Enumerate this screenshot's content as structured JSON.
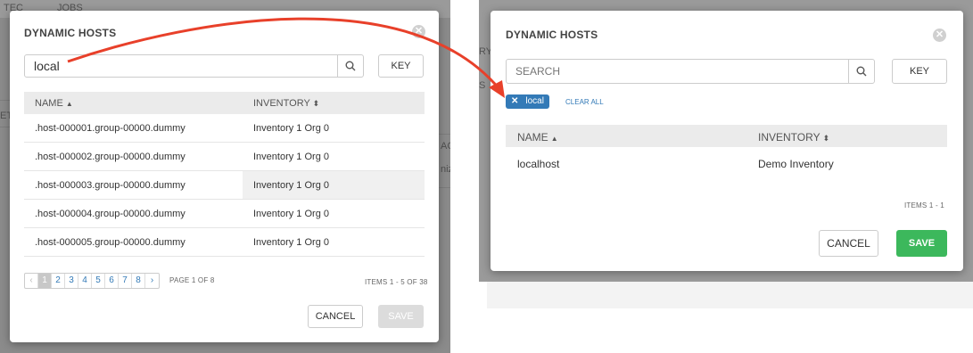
{
  "left": {
    "title": "DYNAMIC HOSTS",
    "search_value": "local",
    "key_label": "KEY",
    "columns": {
      "name": "NAME",
      "inventory": "INVENTORY"
    },
    "rows": [
      {
        "name": ".host-000001.group-00000.dummy",
        "inventory": "Inventory 1 Org 0"
      },
      {
        "name": ".host-000002.group-00000.dummy",
        "inventory": "Inventory 1 Org 0"
      },
      {
        "name": ".host-000003.group-00000.dummy",
        "inventory": "Inventory 1 Org 0"
      },
      {
        "name": ".host-000004.group-00000.dummy",
        "inventory": "Inventory 1 Org 0"
      },
      {
        "name": ".host-000005.group-00000.dummy",
        "inventory": "Inventory 1 Org 0"
      }
    ],
    "pages": [
      "1",
      "2",
      "3",
      "4",
      "5",
      "6",
      "7",
      "8"
    ],
    "page_info": "PAGE 1 OF 8",
    "items_info": "ITEMS  1 - 5 OF 38",
    "cancel_label": "CANCEL",
    "save_label": "SAVE",
    "bg_text": [
      "TEC",
      "JOBS",
      "RY",
      "S",
      "ET",
      "AO",
      "niz"
    ]
  },
  "right": {
    "title": "DYNAMIC HOSTS",
    "search_placeholder": "SEARCH",
    "key_label": "KEY",
    "tag_label": "local",
    "clear_all": "CLEAR ALL",
    "columns": {
      "name": "NAME",
      "inventory": "INVENTORY"
    },
    "rows": [
      {
        "name": "localhost",
        "inventory": "Demo Inventory"
      }
    ],
    "items_info": "ITEMS  1 - 1",
    "cancel_label": "CANCEL",
    "save_label": "SAVE"
  },
  "colors": {
    "accent": "#337ab7",
    "save_green": "#3cb85c",
    "arrow": "#e8402a"
  }
}
